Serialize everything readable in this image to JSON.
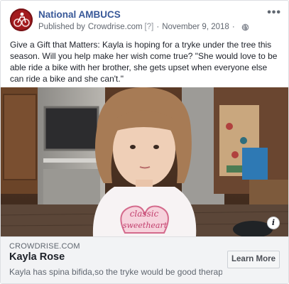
{
  "post": {
    "page_name": "National AMBUCS",
    "published_by_label": "Published by",
    "publisher": "Crowdrise.com",
    "help_marker": "[?]",
    "separator": "·",
    "date": "November 9, 2018",
    "audience_icon": "globe-icon",
    "more_icon": "more-options-icon",
    "more_glyph": "•••",
    "message": "Give a Gift that Matters: Kayla is hoping for a tryke under the tree this season. Will you help make her wish come true? \"She would love to be able ride a bike with her brother, she gets upset when everyone else can ride a bike and she can't.\""
  },
  "photo": {
    "shirt_text_line1": "classic",
    "shirt_text_line2": "sweetheart",
    "info_glyph": "i"
  },
  "link": {
    "domain": "CROWDRISE.COM",
    "title": "Kayla Rose",
    "description": "Kayla has spina bifida,so the tryke would be good therapy...",
    "cta_label": "Learn More"
  },
  "colors": {
    "page_name": "#385898",
    "link_bg": "#f2f3f5",
    "border": "#dddfe2"
  }
}
